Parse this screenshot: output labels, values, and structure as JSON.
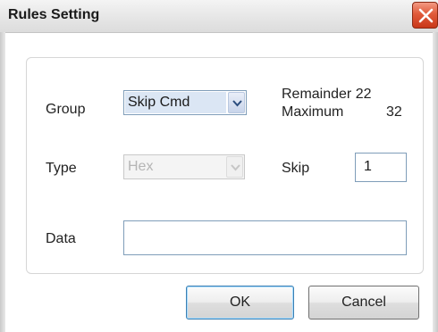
{
  "window": {
    "title": "Rules Setting"
  },
  "form": {
    "group_label": "Group",
    "group_value": "Skip Cmd",
    "remainder_label": "Remainder 22",
    "maximum_label": "Maximum",
    "maximum_value": "32",
    "type_label": "Type",
    "type_value": "Hex",
    "skip_label": "Skip",
    "skip_value": "1",
    "data_label": "Data",
    "data_value": ""
  },
  "buttons": {
    "ok_label": "OK",
    "cancel_label": "Cancel"
  },
  "icons": {
    "close": "close-icon",
    "dropdown": "chevron-down-icon"
  },
  "colors": {
    "close_button": "#d9482a",
    "selection_highlight": "#dbe6f4",
    "disabled_text": "#b5b5b5"
  }
}
